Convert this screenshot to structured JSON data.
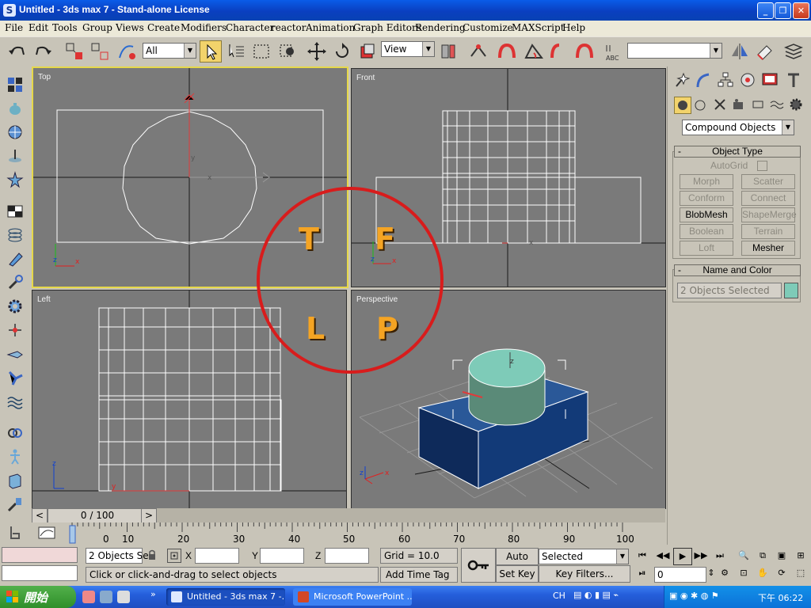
{
  "window": {
    "title": "Untitled - 3ds max 7  - Stand-alone License",
    "minimize_glyph": "_",
    "maximize_glyph": "❐",
    "close_glyph": "✕"
  },
  "menu": [
    "File",
    "Edit",
    "Tools",
    "Group",
    "Views",
    "Create",
    "Modifiers",
    "Character",
    "reactor",
    "Animation",
    "Graph Editors",
    "Rendering",
    "Customize",
    "MAXScript",
    "Help"
  ],
  "toolbar": {
    "selection_filter": "All",
    "reference_coord": "View",
    "named_selection": "",
    "snap_label_3": "3",
    "snap_label_percent": "%"
  },
  "viewports": {
    "top_label": "Top",
    "front_label": "Front",
    "left_label": "Left",
    "perspective_label": "Perspective",
    "axis_x": "x",
    "axis_y": "y",
    "axis_z": "z"
  },
  "overlay": {
    "letter_t": "T",
    "letter_f": "F",
    "letter_l": "L",
    "letter_p": "P",
    "circle_color": "#d81c1c",
    "letter_color": "#f5a423"
  },
  "command_panel": {
    "category": "Compound Objects",
    "object_type_title": "Object Type",
    "autogrid_label": "AutoGrid",
    "buttons": [
      {
        "label": "Morph",
        "enabled": false
      },
      {
        "label": "Scatter",
        "enabled": false
      },
      {
        "label": "Conform",
        "enabled": false
      },
      {
        "label": "Connect",
        "enabled": false
      },
      {
        "label": "BlobMesh",
        "enabled": true
      },
      {
        "label": "ShapeMerge",
        "enabled": false
      },
      {
        "label": "Boolean",
        "enabled": false
      },
      {
        "label": "Terrain",
        "enabled": false
      },
      {
        "label": "Loft",
        "enabled": false
      },
      {
        "label": "Mesher",
        "enabled": true
      }
    ],
    "name_color_title": "Name and Color",
    "name_field": "2 Objects Selected",
    "object_color": "#7ecbb8",
    "collapse_glyph": "-"
  },
  "timeline": {
    "frame_display": "0 / 100",
    "prev_glyph": "<",
    "next_glyph": ">",
    "ticks": [
      "0",
      "10",
      "20",
      "30",
      "40",
      "50",
      "60",
      "70",
      "80",
      "90",
      "100"
    ]
  },
  "status": {
    "selection_count": "2 Objects Se",
    "x_label": "X",
    "y_label": "Y",
    "z_label": "Z",
    "grid": "Grid = 10.0",
    "prompt": "Click or click-and-drag to select objects",
    "add_time_tag": "Add Time Tag",
    "auto_key": "Auto Key",
    "set_key": "Set Key",
    "key_mode": "Selected",
    "key_filters": "Key Filters...",
    "current_frame": "0"
  },
  "taskbar": {
    "start": "開始",
    "tasks": [
      "Untitled - 3ds max 7  -...",
      "Microsoft PowerPoint ..."
    ],
    "tray_lang": "CH",
    "clock": "下午 06:22"
  }
}
